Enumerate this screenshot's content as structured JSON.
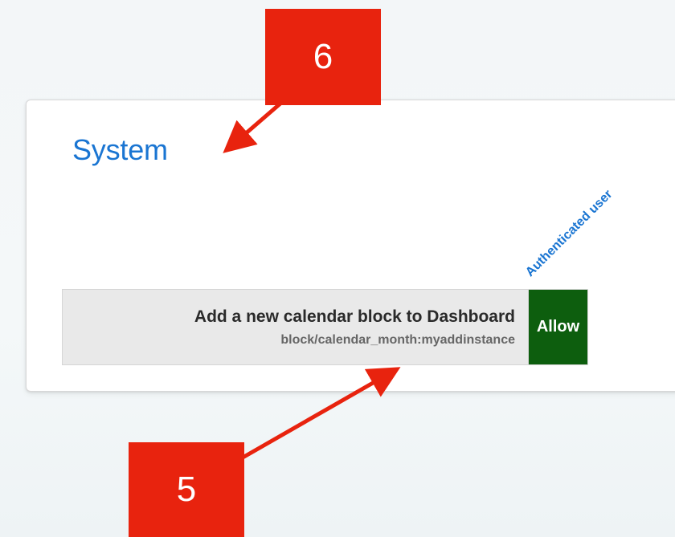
{
  "section": {
    "title": "System"
  },
  "permission_column": {
    "header": "Authenticated user"
  },
  "capability_row": {
    "title": "Add a new calendar block to Dashboard",
    "capability": "block/calendar_month:myaddinstance",
    "permission_label": "Allow"
  },
  "annotations": [
    {
      "number": "6",
      "points_to": "section title"
    },
    {
      "number": "5",
      "points_to": "capability name"
    }
  ],
  "colors": {
    "link": "#1a75d2",
    "allow_bg": "#0d5e0e",
    "callout_red": "#e8230e",
    "capability_cell_bg": "#e9e9e9"
  }
}
